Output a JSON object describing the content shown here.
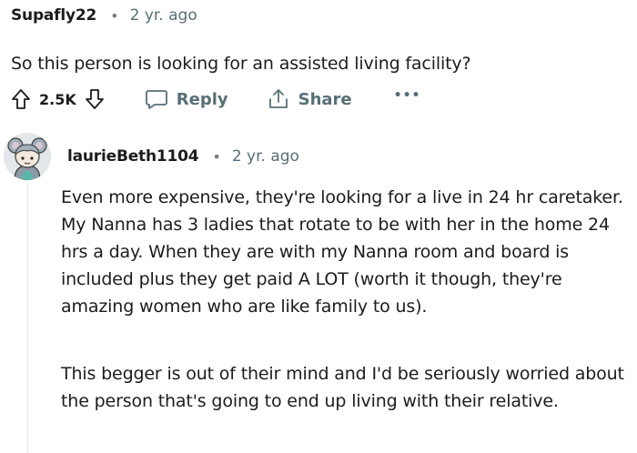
{
  "comment1": {
    "username": "Supafly22",
    "separator": "•",
    "timestamp": "2 yr. ago",
    "body": "So this person is looking for an assisted living facility?",
    "actions": {
      "score": "2.5K",
      "reply_label": "Reply",
      "share_label": "Share",
      "more_label": "•••"
    }
  },
  "comment2": {
    "username": "laurieBeth1104",
    "separator": "•",
    "timestamp": "2 yr. ago",
    "paragraphs": [
      "Even more expensive, they're looking for a live in 24 hr caretaker. My Nanna has 3 ladies that rotate to be with her in the home 24 hrs a day. When they are with my Nanna room and board is included plus they get paid A LOT (worth it though, they're amazing women who are like family to us).",
      "This begger is out of their mind and I'd be seriously worried about the person that's going to end up living with their relative."
    ]
  },
  "colors": {
    "text": "#1c1c1c",
    "meta": "#576f76",
    "thread_line": "#e5ebee"
  },
  "icons": [
    "upvote-icon",
    "downvote-icon",
    "reply-icon",
    "share-icon",
    "more-icon",
    "avatar"
  ]
}
